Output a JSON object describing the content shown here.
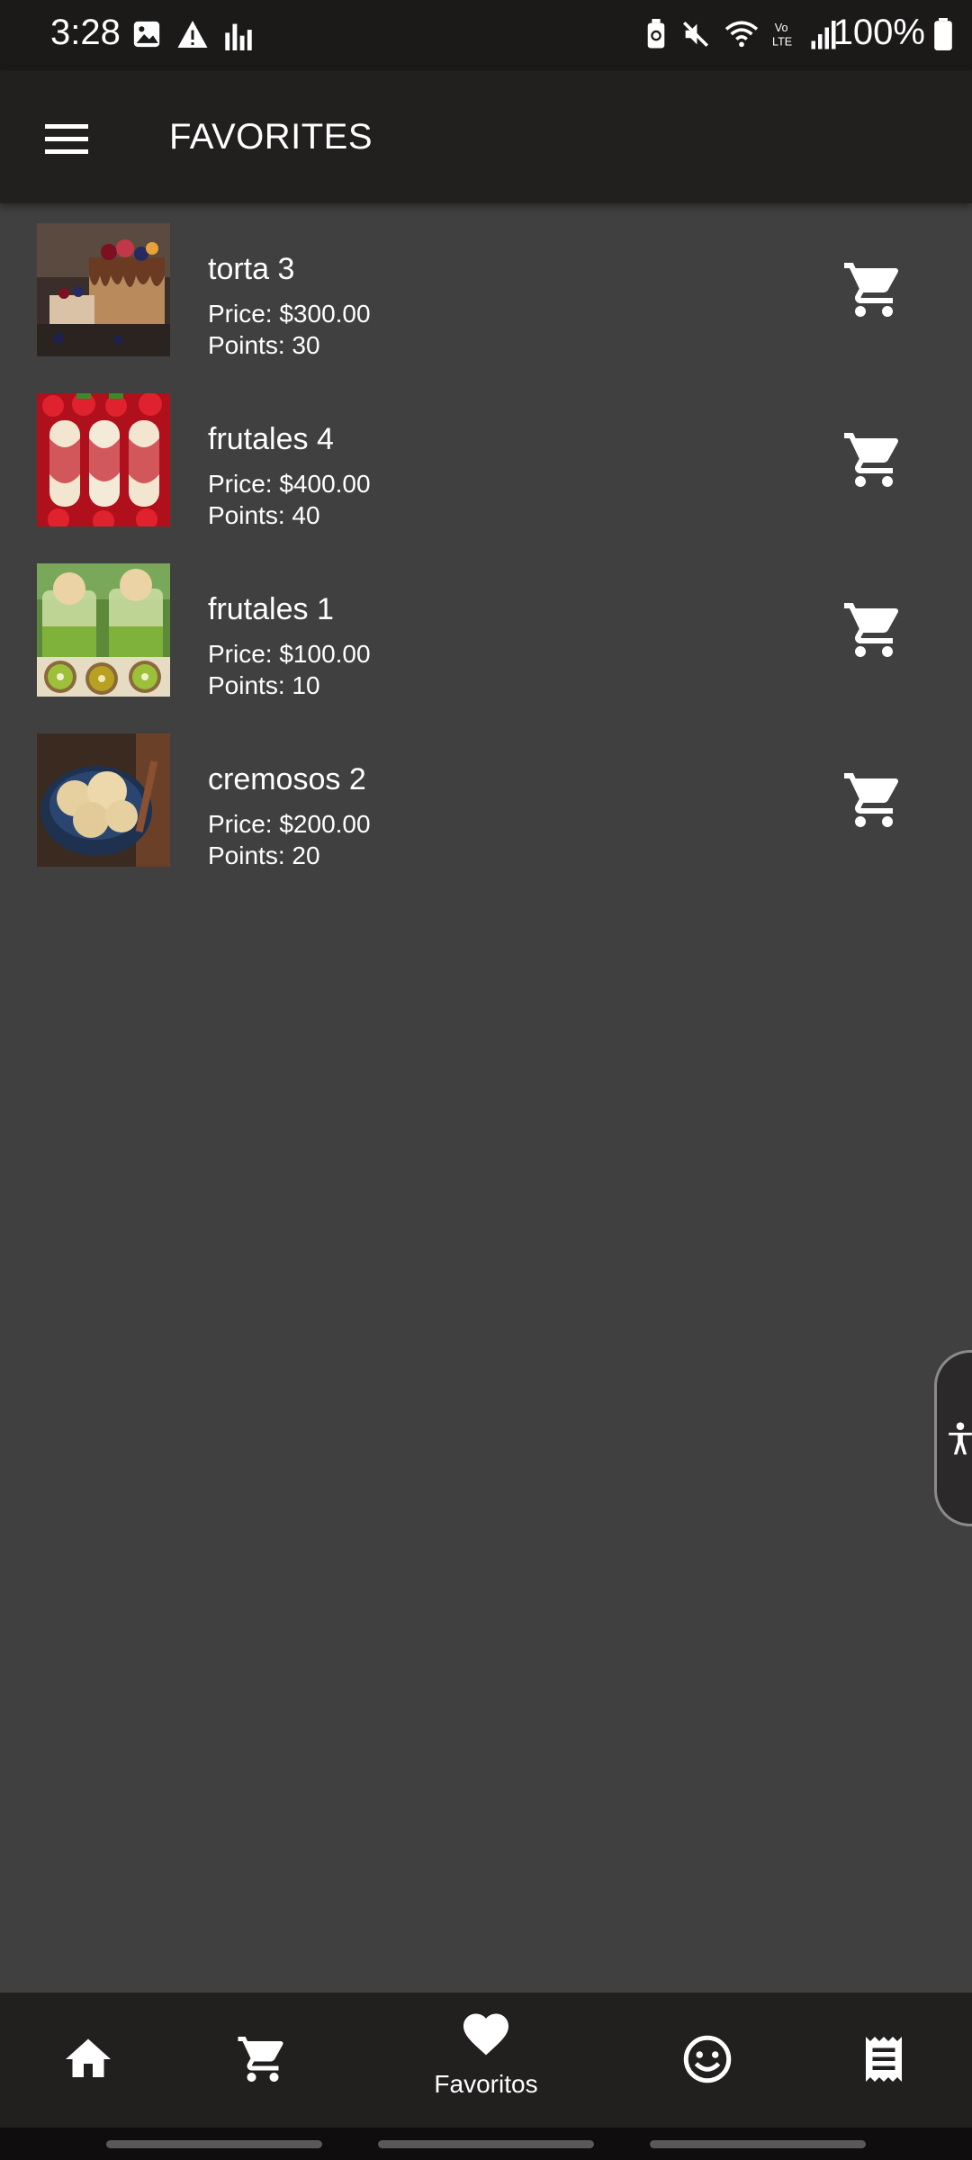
{
  "status_bar": {
    "time": "3:28",
    "battery_text": "100%",
    "left_icons": [
      "image-icon",
      "warning-icon",
      "signal-bars-icon"
    ],
    "right_icons": [
      "battery-saver-icon",
      "mute-icon",
      "wifi-icon",
      "volte-icon",
      "cell-signal-icon",
      "battery-icon"
    ]
  },
  "app_bar": {
    "title": "FAVORITES",
    "menu_icon": "hamburger-menu-icon"
  },
  "favorites": [
    {
      "name": "torta 3",
      "price": "Price: $300.00",
      "points": "Points: 30",
      "image": "layer-cake-photo"
    },
    {
      "name": "frutales 4",
      "price": "Price: $400.00",
      "points": "Points: 40",
      "image": "strawberry-dessert-photo"
    },
    {
      "name": "frutales 1",
      "price": "Price: $100.00",
      "points": "Points: 10",
      "image": "kiwi-ice-cream-photo"
    },
    {
      "name": "cremosos 2",
      "price": "Price: $200.00",
      "points": "Points: 20",
      "image": "vanilla-ice-cream-bowl-photo"
    }
  ],
  "bottom_nav": {
    "items": [
      {
        "icon": "home-icon",
        "label": ""
      },
      {
        "icon": "cart-icon",
        "label": ""
      },
      {
        "icon": "heart-icon",
        "label": "Favoritos",
        "active": true
      },
      {
        "icon": "smiley-icon",
        "label": ""
      },
      {
        "icon": "receipt-icon",
        "label": ""
      }
    ]
  },
  "colors": {
    "background": "#414040",
    "app_bar": "#221f1f",
    "status_bar": "#1c1919",
    "text": "#ffffff"
  }
}
